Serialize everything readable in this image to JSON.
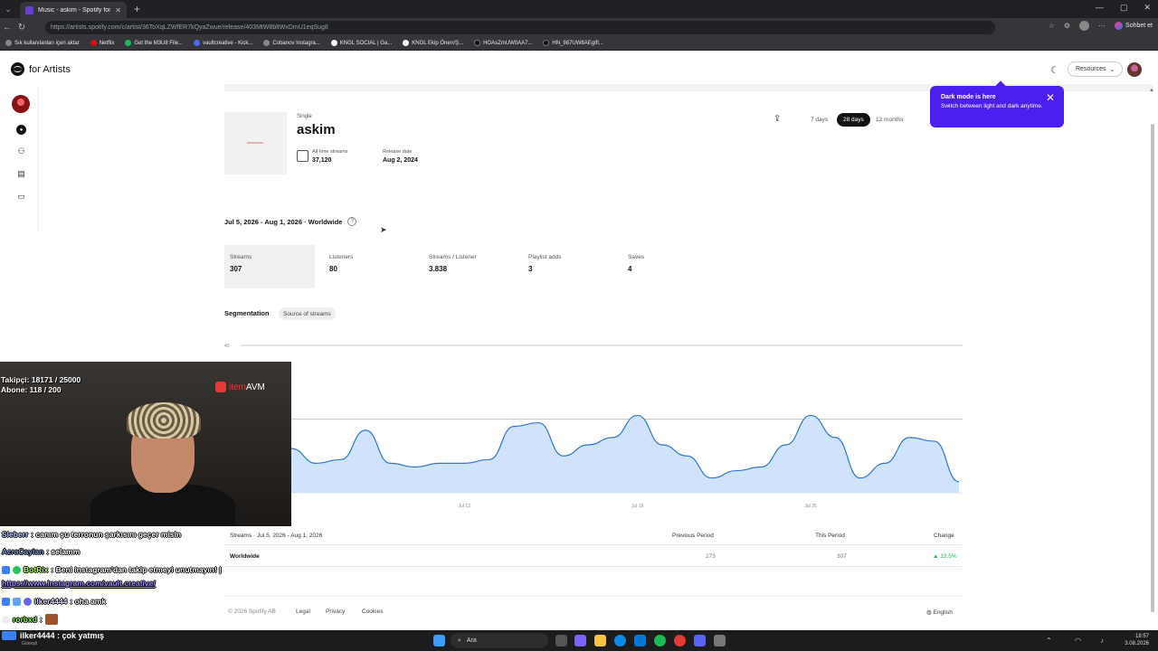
{
  "browser": {
    "tab_title": "Music - askim - Spotify for Artists",
    "url": "https://artists.spotify.com/c/artist/36ToXqLZWfER7kQyaZwue/release/403MtW8bltWxDmU1eqSug8",
    "chat_button": "Sohbet et",
    "bookmarks": [
      "Sık kullanılanları içeri aktar",
      "Netflix",
      "Get the M3U8 File...",
      "vaultcreative - Kick...",
      "Cobanov Instagra...",
      "KNGL SOCIAL | Ga...",
      "KNGL Ekip Önerı/Ş...",
      "HOAsZmUW0AA7...",
      "HN_987UW8AEgIfl..."
    ]
  },
  "header": {
    "brand": "for Artists",
    "resources_label": "Resources"
  },
  "release": {
    "kind": "Single",
    "title": "askim",
    "all_time_label": "All-time streams",
    "all_time_value": "37,120",
    "release_date_label": "Release date",
    "release_date_value": "Aug 2, 2024"
  },
  "range_buttons": [
    "7 days",
    "28 days",
    "12 months"
  ],
  "active_range": "28 days",
  "toast": {
    "title": "Dark mode is here",
    "desc": "Switch between light and dark anytime."
  },
  "period_label": "Jul 5, 2026 - Aug 1, 2026 · Worldwide",
  "metrics": [
    {
      "label": "Streams",
      "value": "307"
    },
    {
      "label": "Listeners",
      "value": "80"
    },
    {
      "label": "Streams / Listener",
      "value": "3.838"
    },
    {
      "label": "Playlist adds",
      "value": "3"
    },
    {
      "label": "Saves",
      "value": "4"
    }
  ],
  "segmentation": {
    "label": "Segmentation",
    "chip": "Source of streams"
  },
  "chart_data": {
    "type": "area",
    "ylim": [
      0,
      40
    ],
    "y_ticks": [
      "40"
    ],
    "x_tick_labels": [
      "Jul 12",
      "Jul 19",
      "Jul 26"
    ],
    "x": [
      "Jul 5",
      "Jul 6",
      "Jul 7",
      "Jul 8",
      "Jul 9",
      "Jul 10",
      "Jul 11",
      "Jul 12",
      "Jul 13",
      "Jul 14",
      "Jul 15",
      "Jul 16",
      "Jul 17",
      "Jul 18",
      "Jul 19",
      "Jul 20",
      "Jul 21",
      "Jul 22",
      "Jul 23",
      "Jul 24",
      "Jul 25",
      "Jul 26",
      "Jul 27",
      "Jul 28",
      "Jul 29",
      "Jul 30",
      "Jul 31",
      "Aug 1"
    ],
    "values": [
      12,
      8,
      9,
      17,
      8,
      7,
      8,
      8,
      9,
      18,
      19,
      10,
      13,
      15,
      21,
      13,
      10,
      4,
      6,
      7,
      13,
      21,
      15,
      4,
      8,
      15,
      14,
      3
    ],
    "color": "#2e77d0",
    "fill": "#cfe4fa"
  },
  "table": {
    "title": "Streams · Jul 5, 2026 - Aug 1, 2026",
    "headers": [
      "Previous Period",
      "This Period",
      "Change"
    ],
    "row_label": "Worldwide",
    "previous": "273",
    "current": "307",
    "change": "▲ 12.5%"
  },
  "footer": {
    "copyright": "© 2026 Spotify AB",
    "links": [
      "Legal",
      "Privacy",
      "Cookies"
    ],
    "language": "English"
  },
  "overlay": {
    "followers": "Takipçi: 18171 / 25000",
    "subs": "Abone: 118 / 200",
    "sponsor_a": "item",
    "sponsor_b": "AVM",
    "chat": [
      {
        "user": "Sleberr",
        "msg": ": canım şu terronun şarkısını geçer misin"
      },
      {
        "user": "AzraCaylan",
        "msg": ": selamm"
      },
      {
        "user": "BotRix",
        "msg": ": Beni instagram'dan takip etmeyi unutmayın! |"
      },
      {
        "user": "",
        "msg": "https://www.instagram.com/vault.creative/"
      },
      {
        "user": "ilker4444",
        "msg": ": oha amk"
      },
      {
        "user": "rorbxd",
        "msg": ":"
      }
    ],
    "ticker": "ilker4444 : çok yatmış",
    "ticker_sub": "Güneşli"
  },
  "taskbar": {
    "search": "Ara",
    "time": "18:57",
    "date": "3.08.2026"
  }
}
